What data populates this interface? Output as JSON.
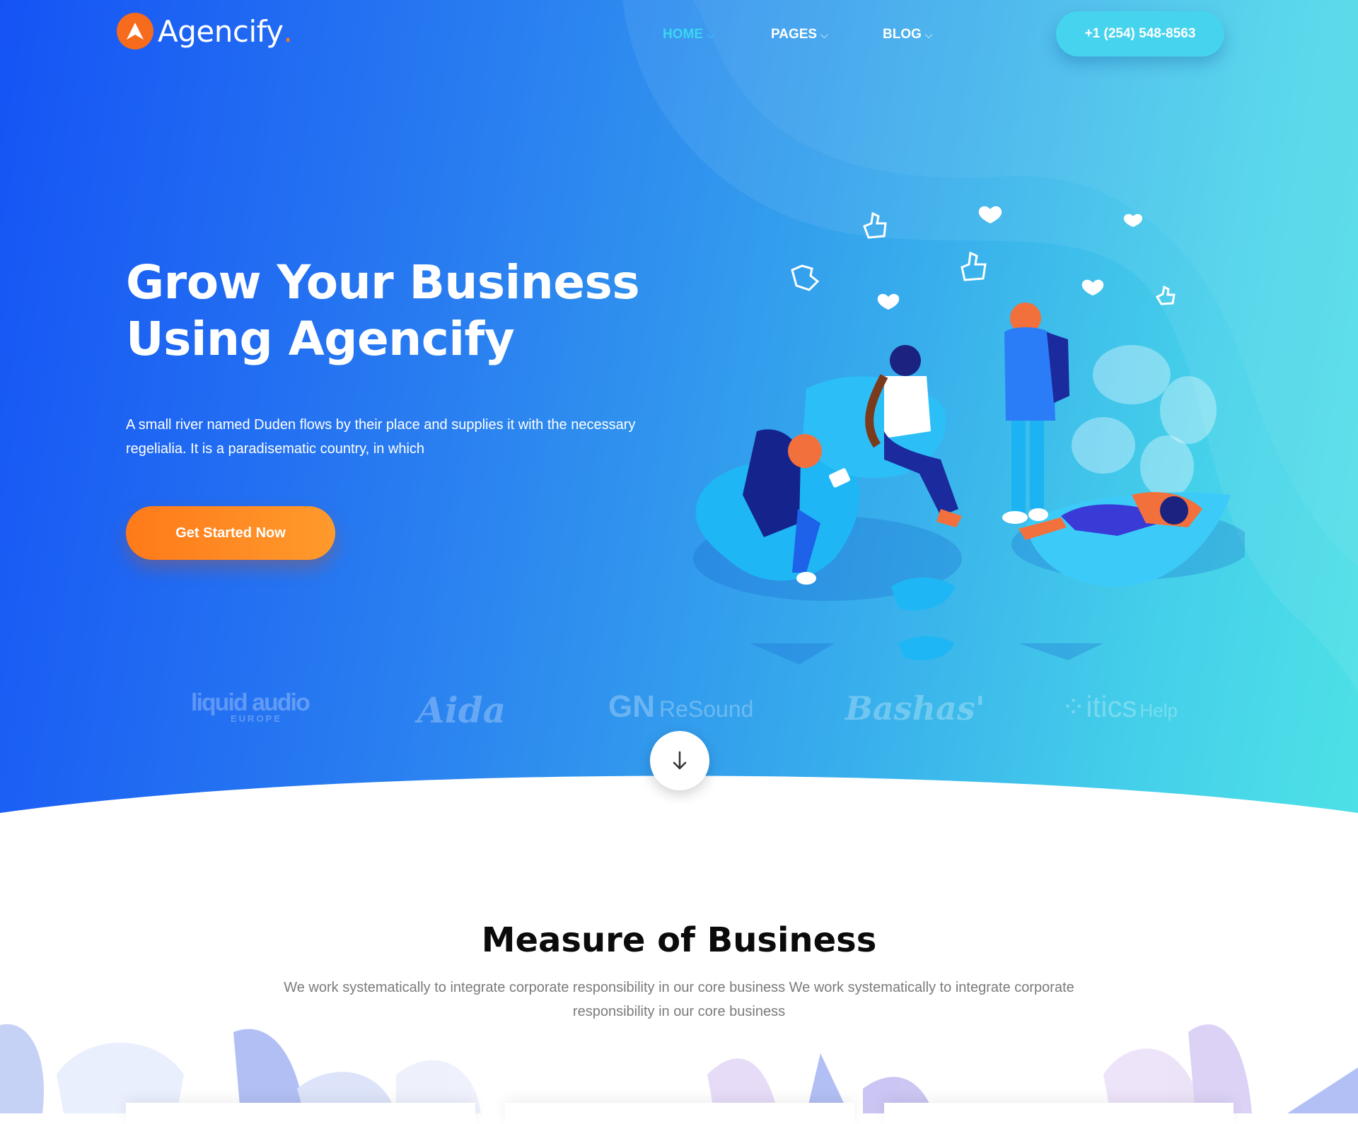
{
  "brand": {
    "name": "Agencify",
    "dot": ".",
    "logo_icon": "a-triangle-icon"
  },
  "nav": {
    "items": [
      {
        "label": "HOME",
        "active": true
      },
      {
        "label": "PAGES",
        "active": false
      },
      {
        "label": "BLOG",
        "active": false
      }
    ],
    "chevron": "⌵",
    "phone": "+1 (254) 548-8563"
  },
  "hero": {
    "title_line1": "Grow Your Business",
    "title_line2": "Using Agencify",
    "description": "A small river named Duden flows by their place and supplies it with the necessary regelialia. It is a paradisematic country, in which",
    "cta": "Get Started Now"
  },
  "partners": {
    "liquid": "liquid audio",
    "liquid_sub": "EUROPE",
    "aida": "Aida",
    "gn": "GN",
    "resound": "ReSound",
    "bashas": "Bashas'",
    "itics": "⁘itics",
    "itics_help": "Help"
  },
  "scroll_icon": "arrow-down-icon",
  "section": {
    "title": "Measure of Business",
    "description": "We work systematically to integrate corporate responsibility in our core business We work systematically to integrate corporate responsibility in our core business"
  },
  "colors": {
    "gradient_start": "#1553f5",
    "gradient_end": "#4de1e6",
    "accent_orange": "#ff7a1a",
    "nav_active": "#3ad6f2"
  }
}
